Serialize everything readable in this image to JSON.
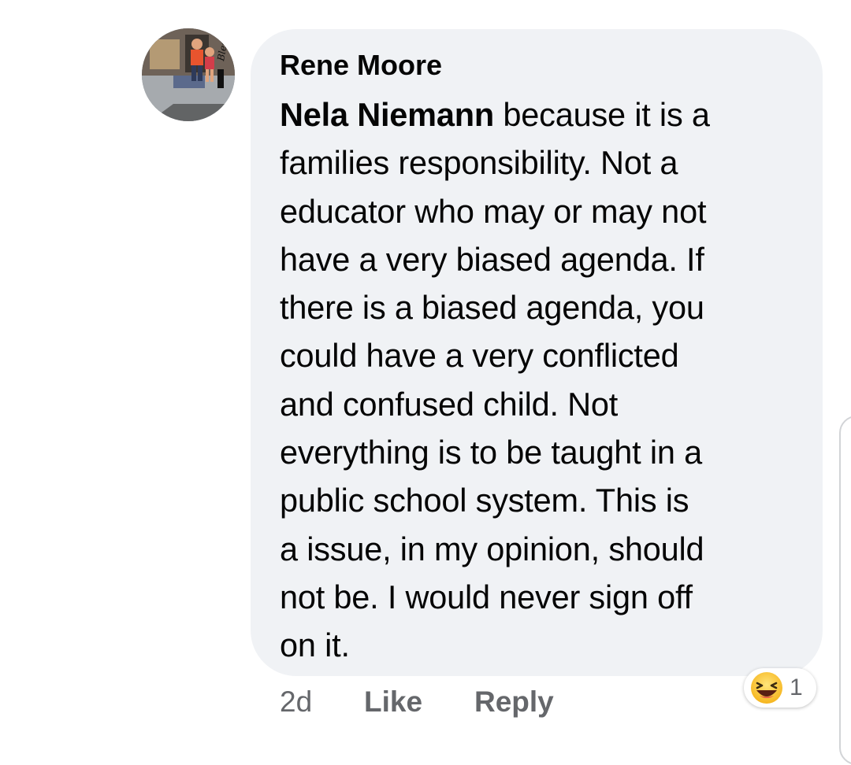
{
  "comment": {
    "author": "Rene Moore",
    "mention": "Nela Niemann",
    "lines": [
      "because it is a",
      "families responsibility. Not a",
      "educator who may or may not",
      "have a very biased agenda. If",
      "there is a biased agenda, you",
      "could have a very conflicted",
      "and confused child. Not",
      "everything is to be taught in a",
      "public school system. This is",
      "a issue, in my opinion, should",
      "not be. I would never sign off",
      "on it."
    ],
    "avatar_badge_text": "Blessed",
    "time": "2d",
    "like_label": "Like",
    "reply_label": "Reply",
    "reaction": {
      "icon": "laughing-emoji-icon",
      "count": "1"
    }
  },
  "colors": {
    "bubble_bg": "#f0f2f5",
    "meta_text": "#65676b",
    "text": "#050505"
  }
}
